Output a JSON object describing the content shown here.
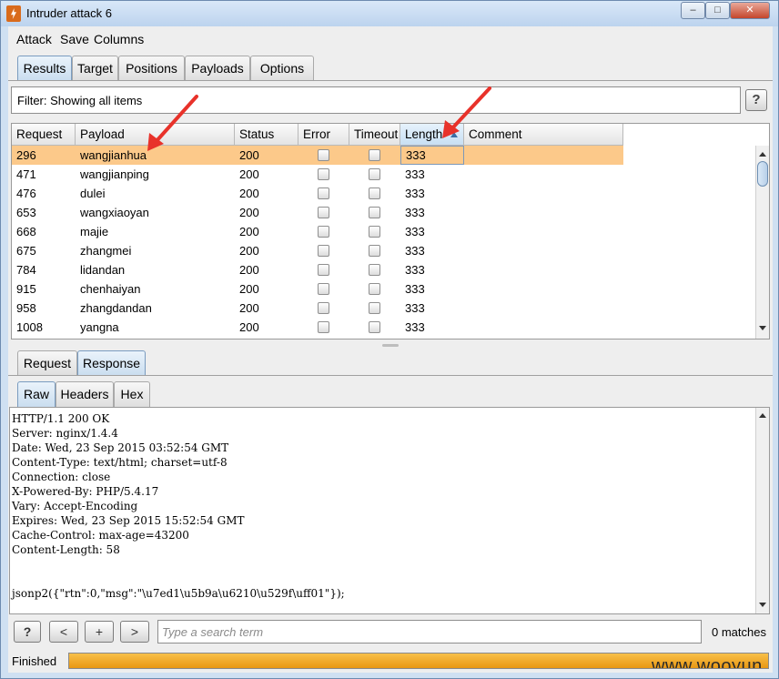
{
  "window": {
    "title": "Intruder attack 6",
    "min_glyph": "–",
    "max_glyph": "□",
    "close_glyph": "✕"
  },
  "menu": [
    "Attack",
    "Save",
    "Columns"
  ],
  "main_tabs": [
    {
      "label": "Results",
      "active": true
    },
    {
      "label": "Target",
      "active": false
    },
    {
      "label": "Positions",
      "active": false
    },
    {
      "label": "Payloads",
      "active": false
    },
    {
      "label": "Options",
      "active": false
    }
  ],
  "filter": {
    "text": "Filter: Showing all items",
    "help_label": "?"
  },
  "results_table": {
    "columns": [
      "Request",
      "Payload",
      "Status",
      "Error",
      "Timeout",
      "Length",
      "Comment"
    ],
    "sorted_column": "Length",
    "rows": [
      {
        "request": "296",
        "payload": "wangjianhua",
        "status": "200",
        "error": false,
        "timeout": false,
        "length": "333",
        "comment": "",
        "selected": true
      },
      {
        "request": "471",
        "payload": "wangjianping",
        "status": "200",
        "error": false,
        "timeout": false,
        "length": "333",
        "comment": "",
        "selected": false
      },
      {
        "request": "476",
        "payload": "dulei",
        "status": "200",
        "error": false,
        "timeout": false,
        "length": "333",
        "comment": "",
        "selected": false
      },
      {
        "request": "653",
        "payload": "wangxiaoyan",
        "status": "200",
        "error": false,
        "timeout": false,
        "length": "333",
        "comment": "",
        "selected": false
      },
      {
        "request": "668",
        "payload": "majie",
        "status": "200",
        "error": false,
        "timeout": false,
        "length": "333",
        "comment": "",
        "selected": false
      },
      {
        "request": "675",
        "payload": "zhangmei",
        "status": "200",
        "error": false,
        "timeout": false,
        "length": "333",
        "comment": "",
        "selected": false
      },
      {
        "request": "784",
        "payload": "lidandan",
        "status": "200",
        "error": false,
        "timeout": false,
        "length": "333",
        "comment": "",
        "selected": false
      },
      {
        "request": "915",
        "payload": "chenhaiyan",
        "status": "200",
        "error": false,
        "timeout": false,
        "length": "333",
        "comment": "",
        "selected": false
      },
      {
        "request": "958",
        "payload": "zhangdandan",
        "status": "200",
        "error": false,
        "timeout": false,
        "length": "333",
        "comment": "",
        "selected": false
      },
      {
        "request": "1008",
        "payload": "yangna",
        "status": "200",
        "error": false,
        "timeout": false,
        "length": "333",
        "comment": "",
        "selected": false
      }
    ]
  },
  "detail_tabs": [
    {
      "label": "Request",
      "active": false
    },
    {
      "label": "Response",
      "active": true
    }
  ],
  "view_tabs": [
    {
      "label": "Raw",
      "active": true
    },
    {
      "label": "Headers",
      "active": false
    },
    {
      "label": "Hex",
      "active": false
    }
  ],
  "response_lines": [
    "HTTP/1.1 200 OK",
    "Server: nginx/1.4.4",
    "Date: Wed, 23 Sep 2015 03:52:54 GMT",
    "Content-Type: text/html; charset=utf-8",
    "Connection: close",
    "X-Powered-By: PHP/5.4.17",
    "Vary: Accept-Encoding",
    "Expires: Wed, 23 Sep 2015 15:52:54 GMT",
    "Cache-Control: max-age=43200",
    "Content-Length: 58",
    "",
    "",
    "jsonp2({\"rtn\":0,\"msg\":\"\\u7ed1\\u5b9a\\u6210\\u529f\\uff01\"});"
  ],
  "search": {
    "help_label": "?",
    "prev_label": "<",
    "add_label": "+",
    "next_label": ">",
    "placeholder": "Type a search term",
    "matches_text": "0 matches"
  },
  "status": {
    "label": "Finished",
    "progress": 1.0
  },
  "watermark": "www.wooyun.org",
  "colors": {
    "selected_row": "#fcc98a",
    "progress": "#f0a623",
    "annotation_arrow": "#e8322a"
  }
}
